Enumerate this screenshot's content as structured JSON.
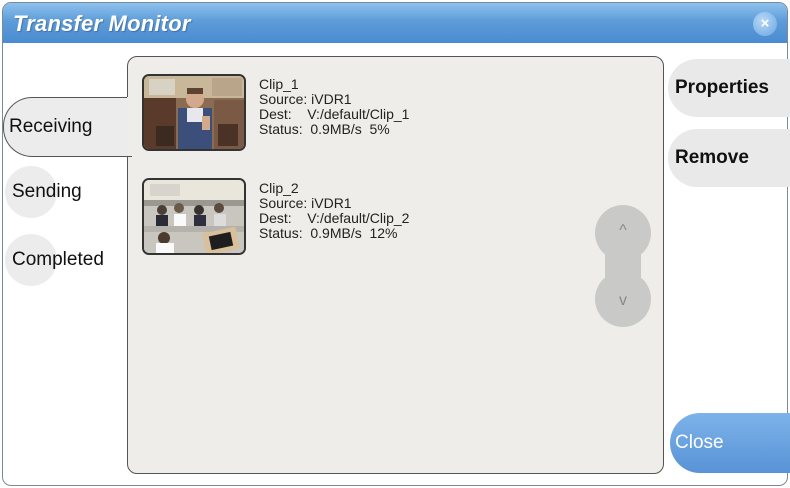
{
  "window": {
    "title": "Transfer Monitor",
    "close_glyph": "×"
  },
  "tabs": [
    {
      "label": "Receiving",
      "active": true
    },
    {
      "label": "Sending",
      "active": false
    },
    {
      "label": "Completed",
      "active": false
    }
  ],
  "clips": [
    {
      "name": "Clip_1",
      "source_line": "Source: iVDR1",
      "dest_line": "Dest:    V:/default/Clip_1",
      "status_line": "Status:  0.9MB/s  5%",
      "thumbnail": "presenter-in-meeting-room"
    },
    {
      "name": "Clip_2",
      "source_line": "Source: iVDR1",
      "dest_line": "Dest:    V:/default/Clip_2",
      "status_line": "Status:  0.9MB/s  12%",
      "thumbnail": "classroom-with-students"
    }
  ],
  "scroll": {
    "up_icon": "chevron-up-icon",
    "down_icon": "chevron-down-icon",
    "up_glyph": "^",
    "down_glyph": "v"
  },
  "actions": {
    "properties_label": "Properties",
    "remove_label": "Remove",
    "close_label": "Close"
  },
  "colors": {
    "titlebar": "#4a8bd1",
    "accent": "#5893d6",
    "panel": "#eeede9"
  }
}
